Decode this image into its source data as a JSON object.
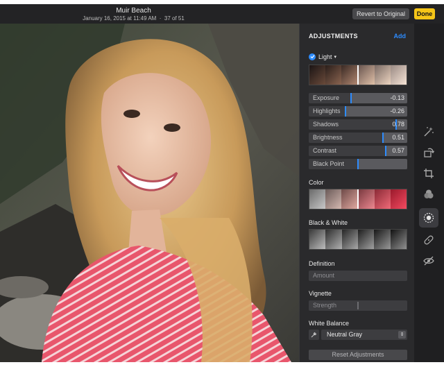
{
  "titlebar": {
    "title": "Muir Beach",
    "date": "January 16, 2015 at 11:49 AM",
    "count": "37 of 51",
    "revert_label": "Revert to Original",
    "done_label": "Done"
  },
  "panel": {
    "header": "ADJUSTMENTS",
    "add_label": "Add",
    "light": {
      "label": "Light",
      "sliders": [
        {
          "label": "Exposure",
          "value": "-0.13",
          "fraction": 0.43
        },
        {
          "label": "Highlights",
          "value": "-0.26",
          "fraction": 0.37
        },
        {
          "label": "Shadows",
          "value": "0.78",
          "fraction": 0.89
        },
        {
          "label": "Brightness",
          "value": "0.51",
          "fraction": 0.75
        },
        {
          "label": "Contrast",
          "value": "0.57",
          "fraction": 0.78
        },
        {
          "label": "Black Point",
          "value": "",
          "fraction": 0.5
        }
      ]
    },
    "color": {
      "label": "Color"
    },
    "bw": {
      "label": "Black & White"
    },
    "definition": {
      "label": "Definition",
      "bar_label": "Amount"
    },
    "vignette": {
      "label": "Vignette",
      "bar_label": "Strength",
      "fraction": 0.5
    },
    "white_balance": {
      "label": "White Balance",
      "selected": "Neutral Gray"
    },
    "reset_label": "Reset Adjustments"
  },
  "tools": [
    {
      "name": "magic-wand-icon"
    },
    {
      "name": "rotate-icon"
    },
    {
      "name": "crop-icon"
    },
    {
      "name": "filters-icon"
    },
    {
      "name": "adjust-icon",
      "active": true
    },
    {
      "name": "bandage-icon"
    },
    {
      "name": "red-eye-icon"
    }
  ],
  "colors": {
    "accent": "#2d8cff",
    "done": "#f5c518",
    "panel_bg": "#2a2a2c"
  }
}
